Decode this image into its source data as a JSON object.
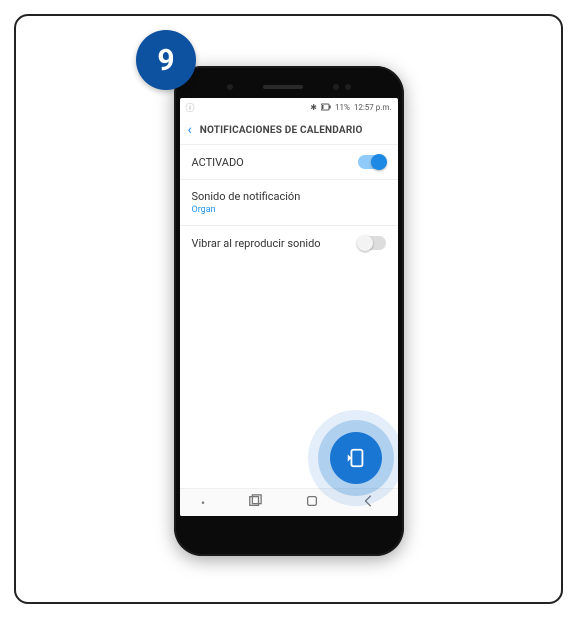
{
  "step": {
    "number": "9"
  },
  "status": {
    "bluetooth": "✱",
    "battery_pct": "11%",
    "time": "12:57 p.m."
  },
  "header": {
    "title": "NOTIFICACIONES DE CALENDARIO"
  },
  "settings": {
    "activated": {
      "label": "ACTIVADO",
      "on": true
    },
    "sound": {
      "label": "Sonido de notificación",
      "value": "Organ"
    },
    "vibrate": {
      "label": "Vibrar al reproducir sonido",
      "on": false
    }
  }
}
